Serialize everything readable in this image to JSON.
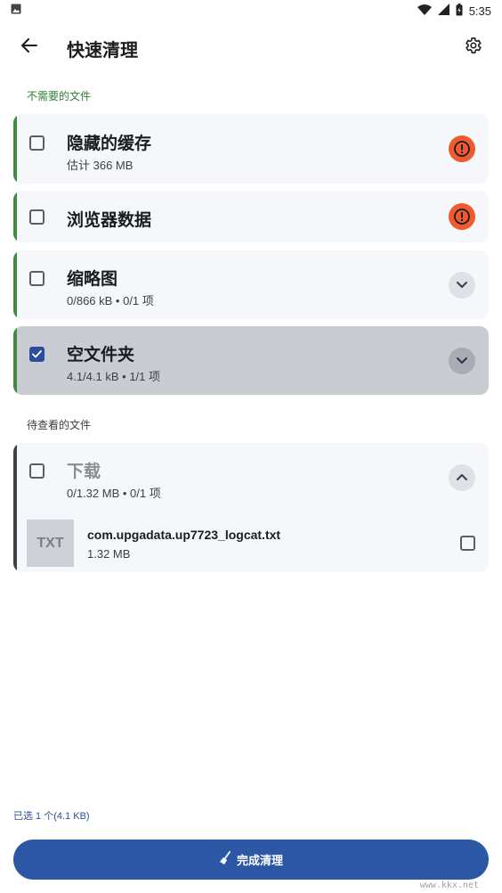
{
  "status_bar": {
    "time": "5:35",
    "icons": [
      "image-icon",
      "wifi-icon",
      "signal-icon",
      "battery-icon"
    ]
  },
  "app_bar": {
    "title": "快速清理",
    "back_icon": "arrow-back-icon",
    "settings_icon": "gear-icon"
  },
  "sections": {
    "unneeded": {
      "label": "不需要的文件",
      "color": "#2e7d32"
    },
    "review": {
      "label": "待查看的文件",
      "color": "#3a3d40"
    }
  },
  "cards": [
    {
      "title": "隐藏的缓存",
      "subtitle": "估计 366 MB",
      "checked": false,
      "action_icon": "warning-icon"
    },
    {
      "title": "浏览器数据",
      "subtitle": "",
      "checked": false,
      "action_icon": "warning-icon"
    },
    {
      "title": "缩略图",
      "subtitle": "0/866 kB • 0/1 项",
      "checked": false,
      "action_icon": "chevron-down-icon"
    },
    {
      "title": "空文件夹",
      "subtitle": "4.1/4.1 kB • 1/1 项",
      "checked": true,
      "action_icon": "chevron-down-icon"
    },
    {
      "title": "下载",
      "subtitle": "0/1.32 MB • 0/1 项",
      "checked": false,
      "action_icon": "chevron-up-icon"
    }
  ],
  "downloads_files": [
    {
      "thumb_label": "TXT",
      "name": "com.upgadata.up7723_logcat.txt",
      "size": "1.32 MB",
      "checked": false
    }
  ],
  "footer": {
    "summary": "已选 1 个(4.1 KB)",
    "button_label": "完成清理",
    "button_icon": "broom-icon"
  },
  "watermark": "www.kkx.net",
  "colors": {
    "accent_green": "#3d8b3f",
    "warning": "#f05a2e",
    "primary": "#2b57a5",
    "checked": "#2b4f9c"
  }
}
